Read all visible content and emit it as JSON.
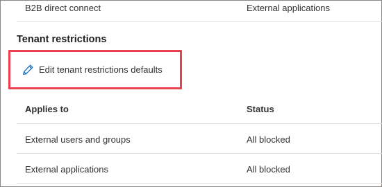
{
  "previous_row": {
    "name": "B2B direct connect",
    "applies_to": "External applications"
  },
  "section": {
    "title": "Tenant restrictions"
  },
  "edit_link": {
    "label": "Edit tenant restrictions defaults",
    "icon": "pencil-icon"
  },
  "highlight_color": "#e8414f",
  "table": {
    "columns": [
      "Applies to",
      "Status"
    ],
    "rows": [
      {
        "applies_to": "External users and groups",
        "status": "All blocked"
      },
      {
        "applies_to": "External applications",
        "status": "All blocked"
      }
    ]
  }
}
